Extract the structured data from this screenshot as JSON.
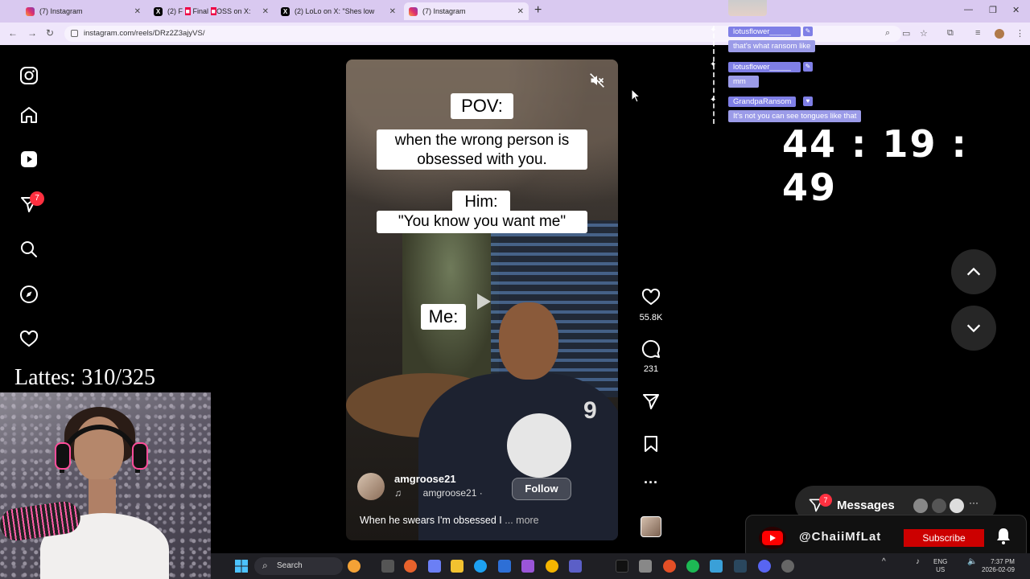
{
  "browser": {
    "tabs": [
      {
        "title": "(7) Instagram",
        "favicon": "instagram-icon",
        "active": false
      },
      {
        "title": "(2) F",
        "favicon": "x-icon",
        "active": false
      },
      {
        "title": "(2) LoLo",
        "favicon": "x-icon",
        "active": false
      },
      {
        "title": "(7) Instagram",
        "favicon": "instagram-icon",
        "active": true
      }
    ],
    "tab2_extra": "Final",
    "tab2_extra2": "OSS on X:",
    "tab3_extra": "on X: \"Shes low",
    "url": "instagram.com/reels/DRz2Z3ajyVS/"
  },
  "overlay": {
    "lattes": "Lattes: 310/325",
    "timer": "44 : 19 : 49",
    "chat": [
      {
        "user": "lotusflower_____",
        "message": "that's what ransom like"
      },
      {
        "user": "lotusflower_____",
        "message": "mm"
      },
      {
        "user": "GrandpaRansom",
        "message": "It's not you can see tongues like that"
      }
    ],
    "subscribe": {
      "handle": "@ChaiiMfLat",
      "button": "Subscribe"
    }
  },
  "instagram": {
    "notification_count": "7",
    "reel": {
      "captions": {
        "pov": "POV:",
        "line1": "when the wrong person is",
        "line2": "obsessed with you.",
        "him": "Him:",
        "quote": "\"You know you want me\"",
        "me": "Me:"
      },
      "author": "amgroose21",
      "audio": "amgroose21 ·",
      "follow_label": "Follow",
      "description": "When he swears I'm obsessed I",
      "more_label": "... more"
    },
    "actions": {
      "likes": "55.8K",
      "comments": "231"
    },
    "messages": {
      "label": "Messages",
      "count": "7"
    }
  },
  "taskbar": {
    "search_label": "Search",
    "lang": "ENG",
    "region": "US",
    "time": "7:37 PM",
    "date": "2026-02-09"
  },
  "colors": {
    "accent_red": "#ff3040",
    "chat_name_bg": "#7f7fe6",
    "youtube_red": "#cc0000",
    "tab_bar": "#d9c9f0"
  }
}
